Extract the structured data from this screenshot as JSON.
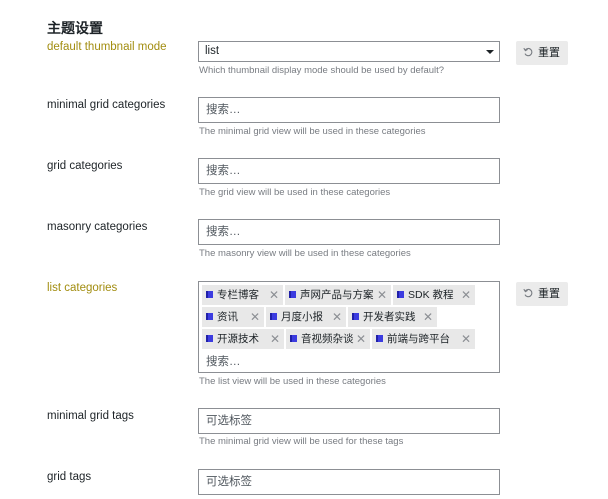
{
  "section": {
    "title": "主题设置"
  },
  "reset_label": "重置",
  "default_thumbnail_mode": {
    "label": "default thumbnail mode",
    "value": "list",
    "description": "Which thumbnail display mode should be used by default?"
  },
  "minimal_grid_categories": {
    "label": "minimal grid categories",
    "placeholder": "搜索…",
    "description": "The minimal grid view will be used in these categories"
  },
  "grid_categories": {
    "label": "grid categories",
    "placeholder": "搜索…",
    "description": "The grid view will be used in these categories"
  },
  "masonry_categories": {
    "label": "masonry categories",
    "placeholder": "搜索…",
    "description": "The masonry view will be used in these categories"
  },
  "list_categories": {
    "label": "list categories",
    "tags": [
      "专栏博客",
      "声网产品与方案",
      "SDK 教程",
      "资讯",
      "月度小报",
      "开发者实践",
      "开源技术",
      "音视频杂谈",
      "前端与跨平台"
    ],
    "remove_glyph": "✕",
    "placeholder": "搜索…",
    "description": "The list view will be used in these categories"
  },
  "minimal_grid_tags": {
    "label": "minimal grid tags",
    "placeholder": "可选标签",
    "description": "The minimal grid view will be used for these tags"
  },
  "grid_tags": {
    "label": "grid tags",
    "placeholder": "可选标签"
  }
}
